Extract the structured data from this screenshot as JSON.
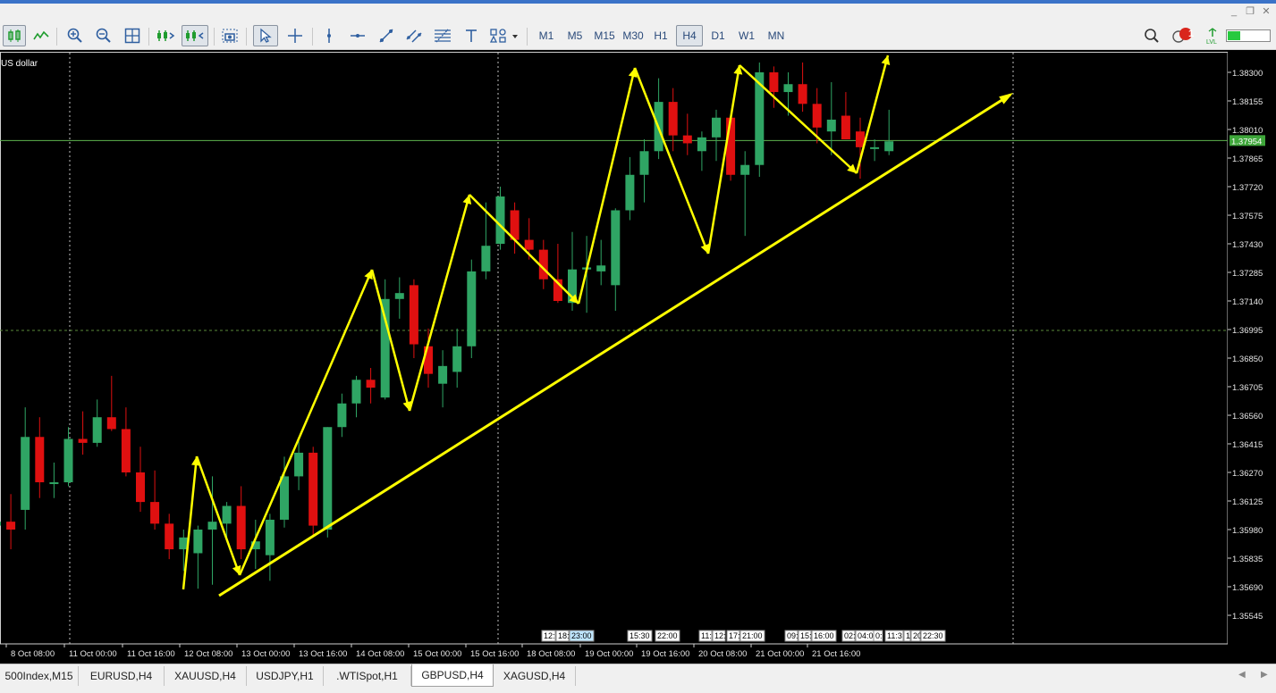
{
  "window_controls": [
    "_",
    "❐",
    "✕"
  ],
  "toolbar": {
    "icons": [
      "candlestick-chart-icon",
      "line-chart-icon",
      "zoom-in-icon",
      "zoom-out-icon",
      "tile-windows-icon",
      "chart-shift-icon",
      "auto-scroll-icon",
      "screenshot-icon",
      "cursor-icon",
      "crosshair-icon",
      "vertical-line-icon",
      "horizontal-line-icon",
      "trendline-icon",
      "channel-icon",
      "fibonacci-icon",
      "text-icon",
      "shapes-icon"
    ],
    "timeframes": [
      "M1",
      "M5",
      "M15",
      "M30",
      "H1",
      "H4",
      "D1",
      "W1",
      "MN"
    ],
    "active_timeframe": "H4",
    "notification_count": "1"
  },
  "chart": {
    "symbol_label": "US dollar",
    "current_price": "1.37954",
    "price_levels": [
      "1.38300",
      "1.38155",
      "1.38010",
      "1.37865",
      "1.37720",
      "1.37575",
      "1.37430",
      "1.37285",
      "1.37140",
      "1.36995",
      "1.36850",
      "1.36705",
      "1.36560",
      "1.36415",
      "1.36270",
      "1.36125",
      "1.35980",
      "1.35835",
      "1.35690",
      "1.35545"
    ],
    "time_labels": [
      "8 Oct 08:00",
      "11 Oct 00:00",
      "11 Oct 16:00",
      "12 Oct 08:00",
      "13 Oct 00:00",
      "13 Oct 16:00",
      "14 Oct 08:00",
      "15 Oct 00:00",
      "15 Oct 16:00",
      "18 Oct 08:00",
      "19 Oct 00:00",
      "19 Oct 16:00",
      "20 Oct 08:00",
      "21 Oct 00:00",
      "21 Oct 16:00"
    ],
    "event_markers": [
      {
        "text": "12:"
      },
      {
        "text": "18:"
      },
      {
        "text": "23:00",
        "highlight": true
      },
      {
        "text": "15:30"
      },
      {
        "text": "22:00"
      },
      {
        "text": "11:"
      },
      {
        "text": "12:"
      },
      {
        "text": "17:"
      },
      {
        "text": "21:00"
      },
      {
        "text": "09:"
      },
      {
        "text": "15:"
      },
      {
        "text": "16:00"
      },
      {
        "text": "02:"
      },
      {
        "text": "04:00"
      },
      {
        "text": "0:"
      },
      {
        "text": "11:3"
      },
      {
        "text": "1"
      },
      {
        "text": "20"
      },
      {
        "text": "22:30"
      }
    ],
    "colors": {
      "bull": "#2fa564",
      "bear": "#e01010",
      "arrows": "#ffff00",
      "price_line": "#5eb54f",
      "grid": "#c0c0c0"
    }
  },
  "tabs": [
    "500Index,M15",
    "EURUSD,H4",
    "XAUUSD,H4",
    "USDJPY,H1",
    ".WTISpot,H1",
    "GBPUSD,H4",
    "XAGUSD,H4"
  ],
  "active_tab": "GBPUSD,H4",
  "chart_data": {
    "type": "candlestick",
    "title": "US dollar",
    "symbol": "GBPUSD",
    "timeframe": "H4",
    "ylim": [
      1.3547,
      1.3836
    ],
    "last_price": 1.37954,
    "candles": [
      [
        1.36,
        1.3612,
        1.359,
        1.3602
      ],
      [
        1.3602,
        1.3616,
        1.3588,
        1.3598
      ],
      [
        1.3608,
        1.366,
        1.3598,
        1.3645
      ],
      [
        1.3645,
        1.3655,
        1.3614,
        1.3622
      ],
      [
        1.3622,
        1.3632,
        1.3614,
        1.3622
      ],
      [
        1.3622,
        1.365,
        1.362,
        1.3644
      ],
      [
        1.3644,
        1.3658,
        1.3636,
        1.3642
      ],
      [
        1.3642,
        1.3664,
        1.364,
        1.3655
      ],
      [
        1.3655,
        1.3676,
        1.3648,
        1.3649
      ],
      [
        1.3649,
        1.366,
        1.3625,
        1.3627
      ],
      [
        1.3627,
        1.364,
        1.3607,
        1.3612
      ],
      [
        1.3612,
        1.3628,
        1.3598,
        1.3601
      ],
      [
        1.3601,
        1.3606,
        1.3583,
        1.3588
      ],
      [
        1.3588,
        1.3598,
        1.3577,
        1.3594
      ],
      [
        1.3586,
        1.36,
        1.3568,
        1.3598
      ],
      [
        1.3598,
        1.3625,
        1.357,
        1.3602
      ],
      [
        1.3601,
        1.3612,
        1.3592,
        1.361
      ],
      [
        1.361,
        1.362,
        1.3583,
        1.3588
      ],
      [
        1.3588,
        1.3603,
        1.3578,
        1.3592
      ],
      [
        1.3585,
        1.3606,
        1.3572,
        1.3603
      ],
      [
        1.3603,
        1.3635,
        1.3599,
        1.3625
      ],
      [
        1.3625,
        1.3645,
        1.3618,
        1.3637
      ],
      [
        1.3637,
        1.364,
        1.3595,
        1.36
      ],
      [
        1.3598,
        1.365,
        1.3594,
        1.365
      ],
      [
        1.365,
        1.3667,
        1.3645,
        1.3662
      ],
      [
        1.3662,
        1.3676,
        1.3655,
        1.3674
      ],
      [
        1.3674,
        1.368,
        1.3662,
        1.367
      ],
      [
        1.3665,
        1.3725,
        1.3664,
        1.3715
      ],
      [
        1.3715,
        1.3726,
        1.3705,
        1.3718
      ],
      [
        1.3722,
        1.3725,
        1.3685,
        1.3692
      ],
      [
        1.3691,
        1.37,
        1.367,
        1.3677
      ],
      [
        1.3672,
        1.3689,
        1.366,
        1.3681
      ],
      [
        1.3678,
        1.37,
        1.367,
        1.3691
      ],
      [
        1.3691,
        1.3735,
        1.3685,
        1.3729
      ],
      [
        1.3729,
        1.3764,
        1.3725,
        1.3742
      ],
      [
        1.3743,
        1.3772,
        1.374,
        1.3767
      ],
      [
        1.376,
        1.3764,
        1.3738,
        1.3745
      ],
      [
        1.3745,
        1.3756,
        1.3735,
        1.374
      ],
      [
        1.374,
        1.3745,
        1.372,
        1.3725
      ],
      [
        1.3725,
        1.3743,
        1.3713,
        1.3714
      ],
      [
        1.3713,
        1.3749,
        1.3709,
        1.373
      ],
      [
        1.373,
        1.3747,
        1.3708,
        1.3731
      ],
      [
        1.3729,
        1.3745,
        1.3722,
        1.3732
      ],
      [
        1.3722,
        1.3761,
        1.3709,
        1.376
      ],
      [
        1.376,
        1.3787,
        1.3755,
        1.3778
      ],
      [
        1.3778,
        1.3796,
        1.3764,
        1.379
      ],
      [
        1.379,
        1.3827,
        1.3786,
        1.3815
      ],
      [
        1.3815,
        1.3822,
        1.379,
        1.3798
      ],
      [
        1.3798,
        1.3809,
        1.3788,
        1.3794
      ],
      [
        1.379,
        1.38,
        1.378,
        1.3797
      ],
      [
        1.3797,
        1.3811,
        1.3785,
        1.3807
      ],
      [
        1.3807,
        1.3808,
        1.3775,
        1.3778
      ],
      [
        1.3778,
        1.379,
        1.3747,
        1.3783
      ],
      [
        1.3783,
        1.3835,
        1.3777,
        1.383
      ],
      [
        1.383,
        1.3833,
        1.3812,
        1.382
      ],
      [
        1.382,
        1.383,
        1.3808,
        1.3824
      ],
      [
        1.3824,
        1.3835,
        1.381,
        1.3814
      ],
      [
        1.3814,
        1.3822,
        1.3794,
        1.3802
      ],
      [
        1.38,
        1.3825,
        1.3788,
        1.3806
      ],
      [
        1.3808,
        1.382,
        1.3796,
        1.3796
      ],
      [
        1.38,
        1.3807,
        1.3776,
        1.3792
      ],
      [
        1.3792,
        1.3796,
        1.3785,
        1.3792
      ],
      [
        1.379,
        1.3811,
        1.3788,
        1.3795
      ]
    ],
    "annotations": [
      {
        "kind": "trendline",
        "from": [
          "12 Oct 08:00",
          1.3568
        ],
        "to": [
          "22 Oct 08:00",
          1.3825
        ]
      },
      {
        "kind": "zigzag",
        "points": [
          [
            1.357
          ],
          [
            1.3637
          ],
          [
            1.3578
          ],
          [
            1.3729
          ],
          [
            1.3661
          ],
          [
            1.3768
          ],
          [
            1.3711
          ],
          [
            1.3833
          ],
          [
            1.3744
          ],
          [
            1.3833
          ],
          [
            1.3783
          ],
          [
            1.384
          ]
        ]
      }
    ]
  }
}
